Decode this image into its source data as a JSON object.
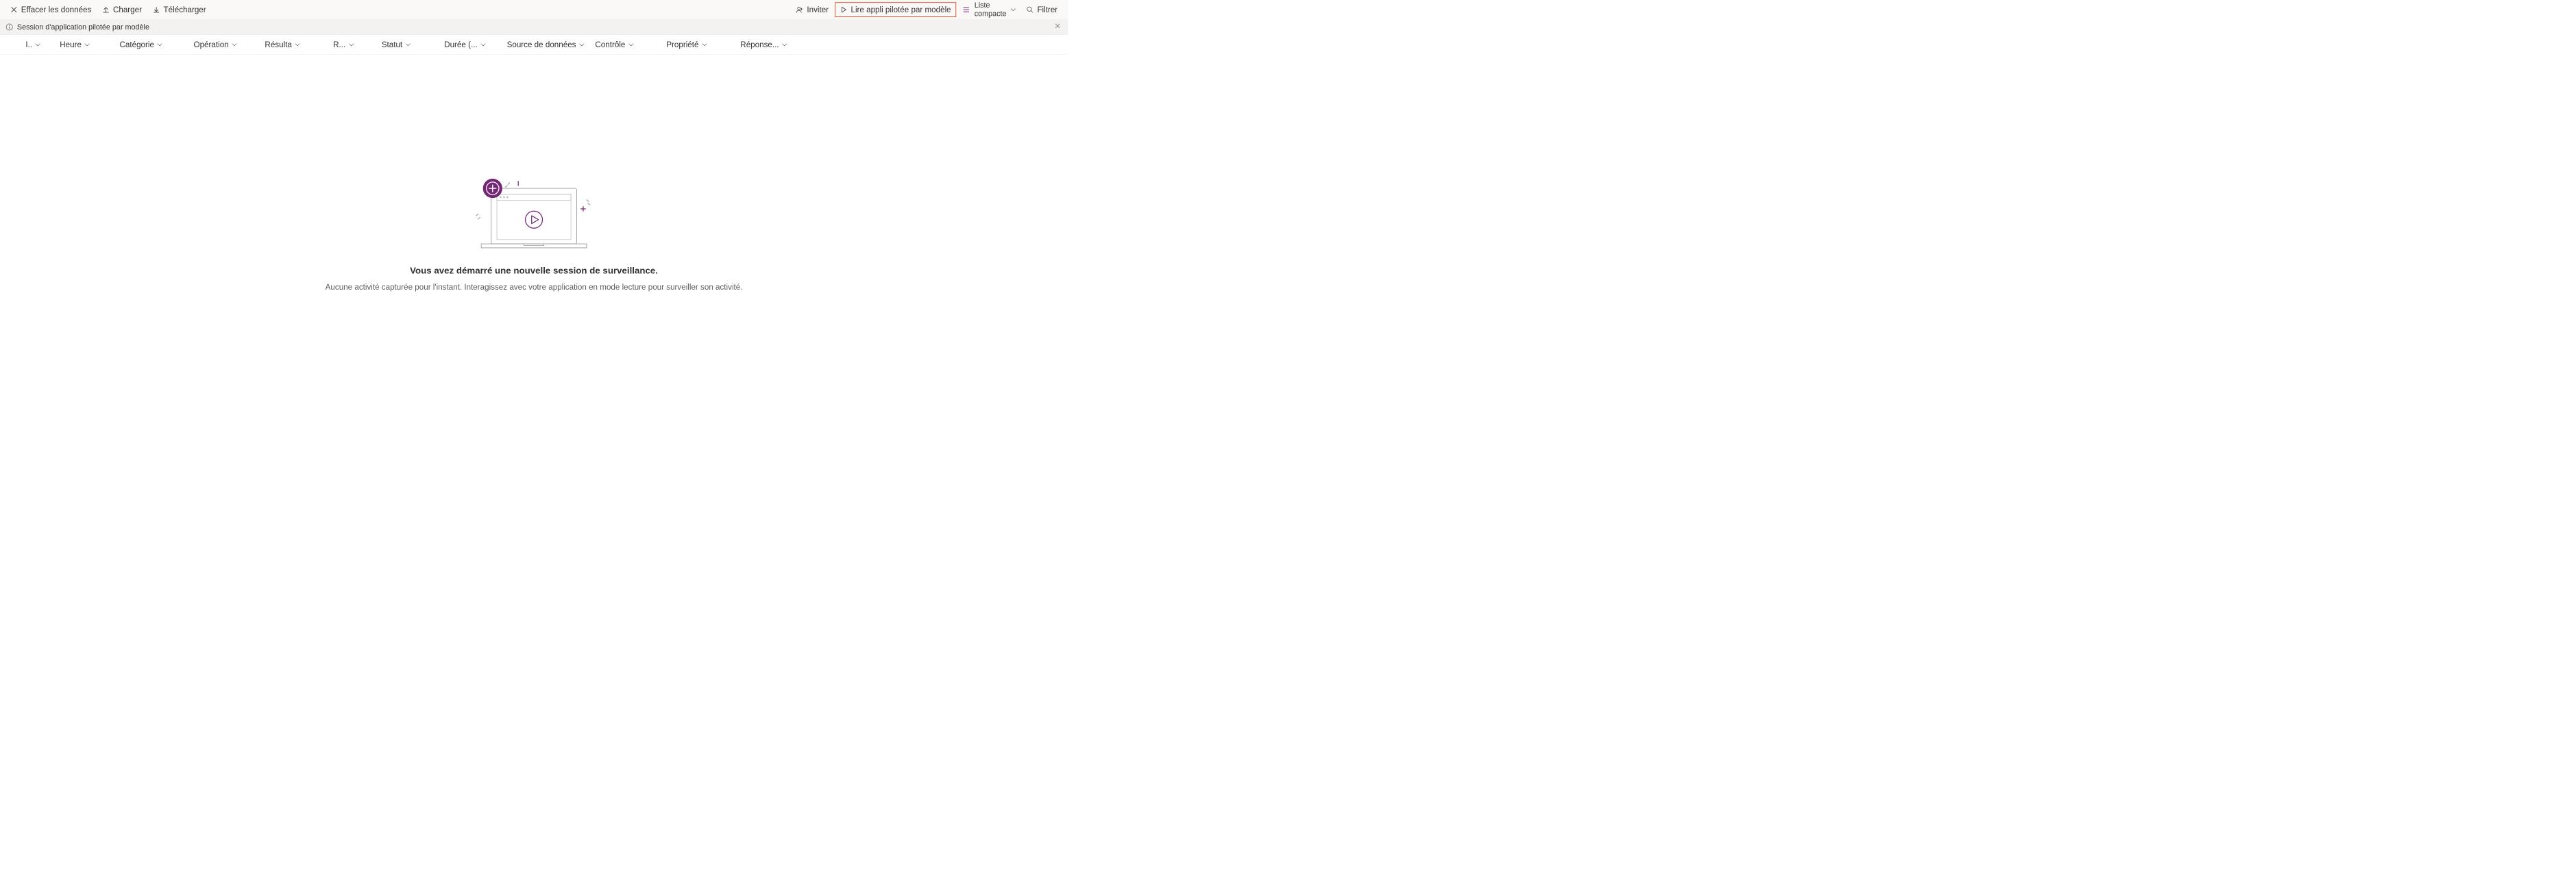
{
  "toolbar": {
    "clear": "Effacer les données",
    "load": "Charger",
    "download": "Télécharger",
    "invite": "Inviter",
    "play": "Lire appli pilotée par modèle",
    "list_line1": "Liste",
    "list_line2": "compacte",
    "filter": "Filtrer"
  },
  "info_bar": "Session d'application pilotée par modèle",
  "columns": {
    "id": "I..",
    "heure": "Heure",
    "categorie": "Catégorie",
    "operation": "Opération",
    "resulta": "Résulta",
    "r": "R...",
    "statut": "Statut",
    "duree": "Durée (...",
    "source": "Source de données",
    "controle": "Contrôle",
    "propriete": "Propriété",
    "reponse": "Réponse..."
  },
  "empty": {
    "title": "Vous avez démarré une nouvelle session de surveillance.",
    "subtitle": "Aucune activité capturée pour l'instant. Interagissez avec votre application en mode lecture pour surveiller son activité."
  },
  "colors": {
    "accent": "#742774",
    "highlight": "#d83b01"
  }
}
